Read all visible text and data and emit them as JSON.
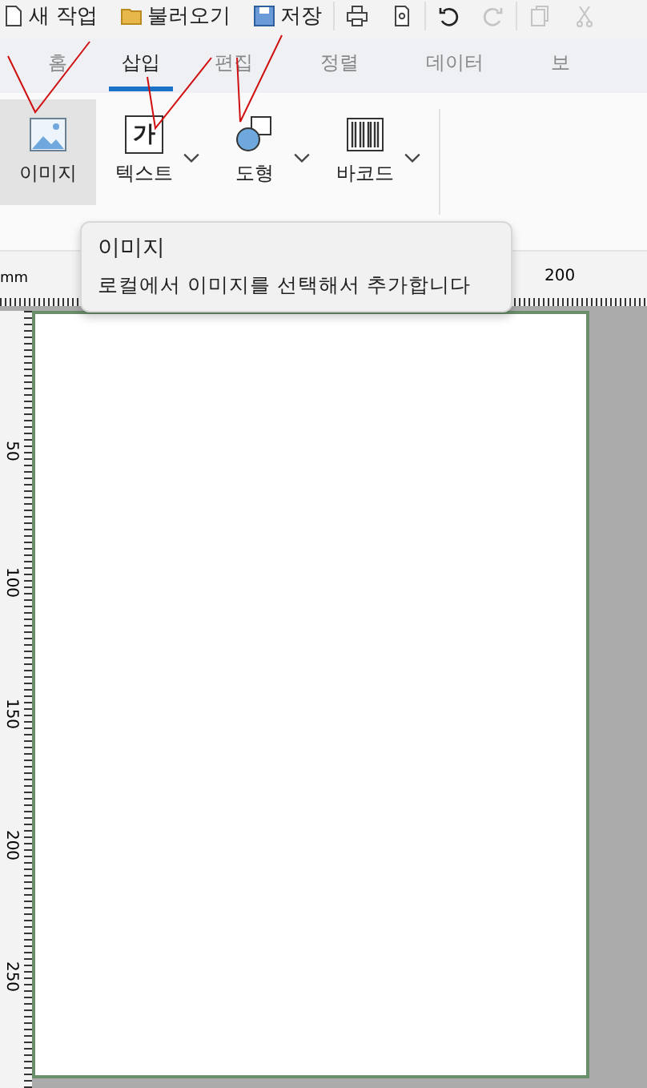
{
  "toolbar": [
    {
      "kind": "new",
      "label": "새 작업",
      "disabled": false
    },
    {
      "kind": "open",
      "label": "불러오기",
      "disabled": false
    },
    {
      "kind": "save",
      "label": "저장",
      "disabled": false
    },
    {
      "kind": "print"
    },
    {
      "kind": "preview"
    },
    {
      "kind": "undo",
      "disabled": false
    },
    {
      "kind": "redo",
      "disabled": true
    },
    {
      "kind": "copy",
      "disabled": true
    },
    {
      "kind": "cut",
      "disabled": true
    }
  ],
  "tabs": [
    {
      "label": "홈",
      "selected": false
    },
    {
      "label": "삽입",
      "selected": true
    },
    {
      "label": "편집",
      "selected": false
    },
    {
      "label": "정렬",
      "selected": false
    },
    {
      "label": "데이터",
      "selected": false
    },
    {
      "label": "보",
      "selected": false
    }
  ],
  "ribbon": {
    "buttons": [
      {
        "kind": "image",
        "label": "이미지",
        "selected": true,
        "dropdown": false
      },
      {
        "kind": "text",
        "label": "텍스트",
        "selected": false,
        "dropdown": true,
        "glyph": "가"
      },
      {
        "kind": "shape",
        "label": "도형",
        "selected": false,
        "dropdown": true
      },
      {
        "kind": "barcode",
        "label": "바코드",
        "selected": false,
        "dropdown": true
      }
    ]
  },
  "tooltip": {
    "title": "이미지",
    "text": "로컬에서 이미지를 선택해서 추가합니다"
  },
  "ruler": {
    "unit": "mm",
    "top_labels": [
      "200"
    ],
    "side_labels": [
      "50",
      "100",
      "150",
      "200",
      "250"
    ]
  }
}
